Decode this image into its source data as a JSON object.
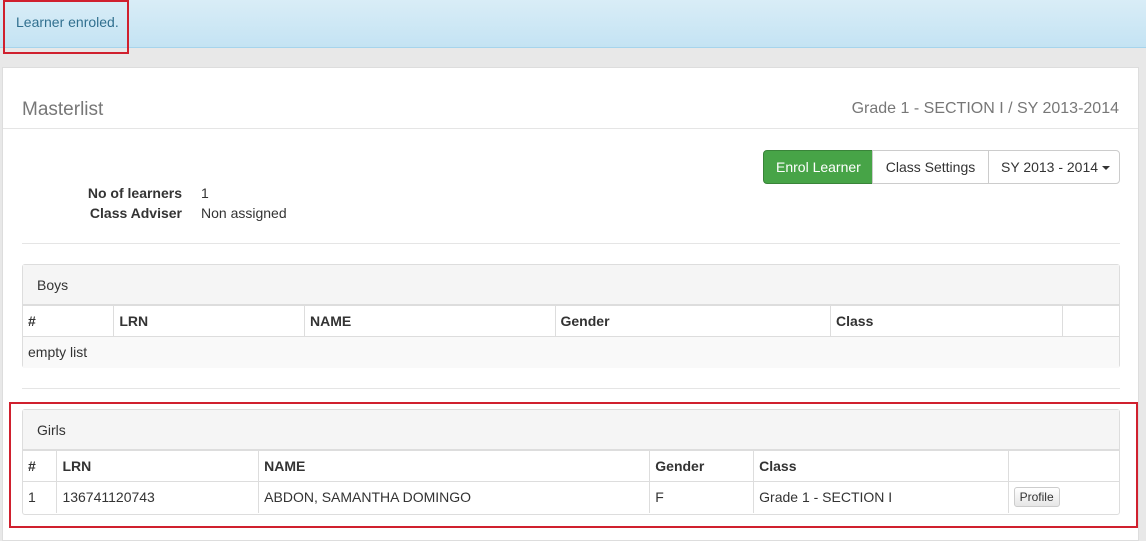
{
  "alert": {
    "message": "Learner enroled."
  },
  "panel": {
    "title": "Masterlist",
    "subtitle": "Grade 1 - SECTION I / SY 2013-2014"
  },
  "toolbar": {
    "enrol_label": "Enrol Learner",
    "settings_label": "Class Settings",
    "sy_label": "SY 2013 - 2014"
  },
  "info": {
    "learners_label": "No of learners",
    "learners_value": "1",
    "adviser_label": "Class Adviser",
    "adviser_value": "Non assigned"
  },
  "boys": {
    "title": "Boys",
    "columns": [
      "#",
      "LRN",
      "NAME",
      "Gender",
      "Class",
      ""
    ],
    "empty_text": "empty list"
  },
  "girls": {
    "title": "Girls",
    "columns": [
      "#",
      "LRN",
      "NAME",
      "Gender",
      "Class",
      ""
    ],
    "rows": [
      {
        "num": "1",
        "lrn": "136741120743",
        "name": "ABDON, SAMANTHA DOMINGO",
        "gender": "F",
        "class": "Grade 1 - SECTION I",
        "action": "Profile"
      }
    ]
  },
  "colors": {
    "alert_bg": "#d9edf7",
    "success": "#47a447",
    "highlight": "#d0202e"
  }
}
